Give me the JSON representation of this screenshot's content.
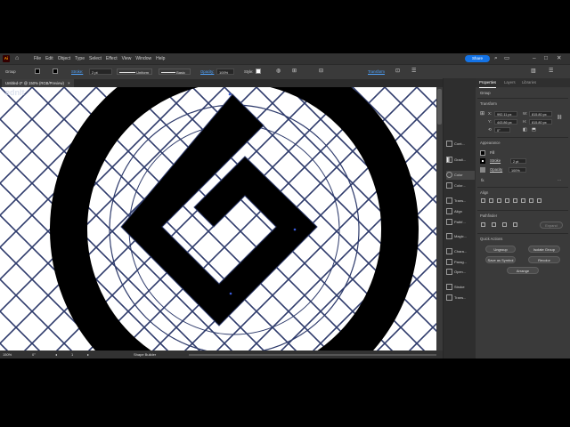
{
  "app": {
    "logo_text": "Ai",
    "menus": [
      "File",
      "Edit",
      "Object",
      "Type",
      "Select",
      "Effect",
      "View",
      "Window",
      "Help"
    ],
    "share_label": "Share"
  },
  "control_bar": {
    "selection_label": "Group",
    "stroke_label": "Stroke:",
    "stroke_value": "2 pt",
    "uniform_label": "Uniform",
    "basic_label": "Basic",
    "opacity_label": "Opacity:",
    "opacity_value": "100%",
    "style_label": "Style:",
    "transform_label": "Transform"
  },
  "document_tab": {
    "title": "Untitled-2* @ 150% (RGB/Preview)",
    "close": "×"
  },
  "status_bar": {
    "zoom": "150%",
    "angle": "0°",
    "page": "1",
    "tool_label": "Shape Builder"
  },
  "tools_strip": [
    {
      "label": "Cont..."
    },
    {
      "label": "Gradi..."
    },
    {
      "label": "Color"
    },
    {
      "label": "Color..."
    },
    {
      "label": "Trans..."
    },
    {
      "label": "Align"
    },
    {
      "label": "Pathf..."
    },
    {
      "label": "Magic..."
    },
    {
      "label": "Chara..."
    },
    {
      "label": "Parag..."
    },
    {
      "label": "Open..."
    },
    {
      "label": "Stroke"
    },
    {
      "label": "Trans..."
    }
  ],
  "properties": {
    "tabs": [
      "Properties",
      "Layers",
      "Libraries"
    ],
    "group_title": "Group",
    "transform_title": "Transform",
    "x_label": "X:",
    "x_value": "992.11 px",
    "w_label": "W:",
    "w_value": "815.80 px",
    "y_label": "Y:",
    "y_value": "443.86 px",
    "h_label": "H:",
    "h_value": "815.80 px",
    "angle_value": "0°",
    "appearance_title": "Appearance",
    "fill_label": "Fill",
    "stroke_label": "Stroke",
    "stroke_value": "2 pt",
    "opacity_label": "Opacity",
    "opacity_value": "100%",
    "fx_label": "fx.",
    "align_title": "Align",
    "pathfinder_title": "Pathfinder",
    "expand_label": "Expand",
    "quick_actions_title": "Quick Actions",
    "ungroup_label": "Ungroup",
    "isolate_label": "Isolate Group",
    "save_symbol_label": "Save as Symbol",
    "recolor_label": "Recolor",
    "arrange_label": "Arrange"
  },
  "colors": {
    "ui_dark": "#323232",
    "panel": "#3a3a3a",
    "accent_blue": "#1473e6",
    "artboard": "#ffffff",
    "art_fill": "#000000",
    "guide_line": "#2d3a6b"
  }
}
